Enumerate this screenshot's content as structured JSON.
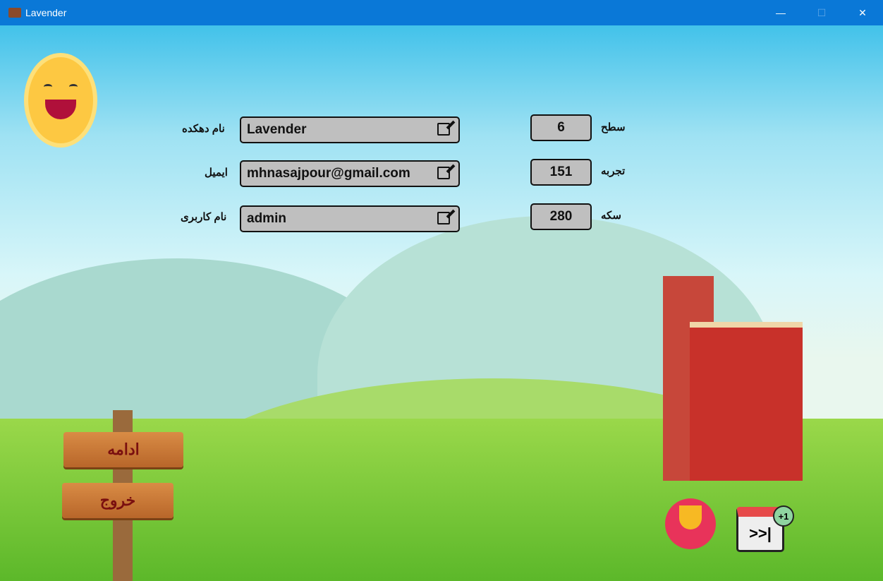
{
  "window": {
    "title": "Lavender",
    "minimize": "—",
    "maximize": "☐",
    "close": "✕"
  },
  "profile": {
    "village_name": {
      "label": "نام دهکده",
      "value": "Lavender"
    },
    "email": {
      "label": "ایمیل",
      "value": "mhnasajpour@gmail.com"
    },
    "username": {
      "label": "نام کاربری",
      "value": "admin"
    }
  },
  "stats": {
    "level": {
      "label": "سطح",
      "value": "6"
    },
    "experience": {
      "label": "تجربه",
      "value": "151"
    },
    "coins": {
      "label": "سکه",
      "value": "280"
    }
  },
  "buttons": {
    "continue": "ادامه",
    "exit": "خروج"
  },
  "daily_reward": {
    "badge": "+1",
    "glyph": ">>|"
  }
}
